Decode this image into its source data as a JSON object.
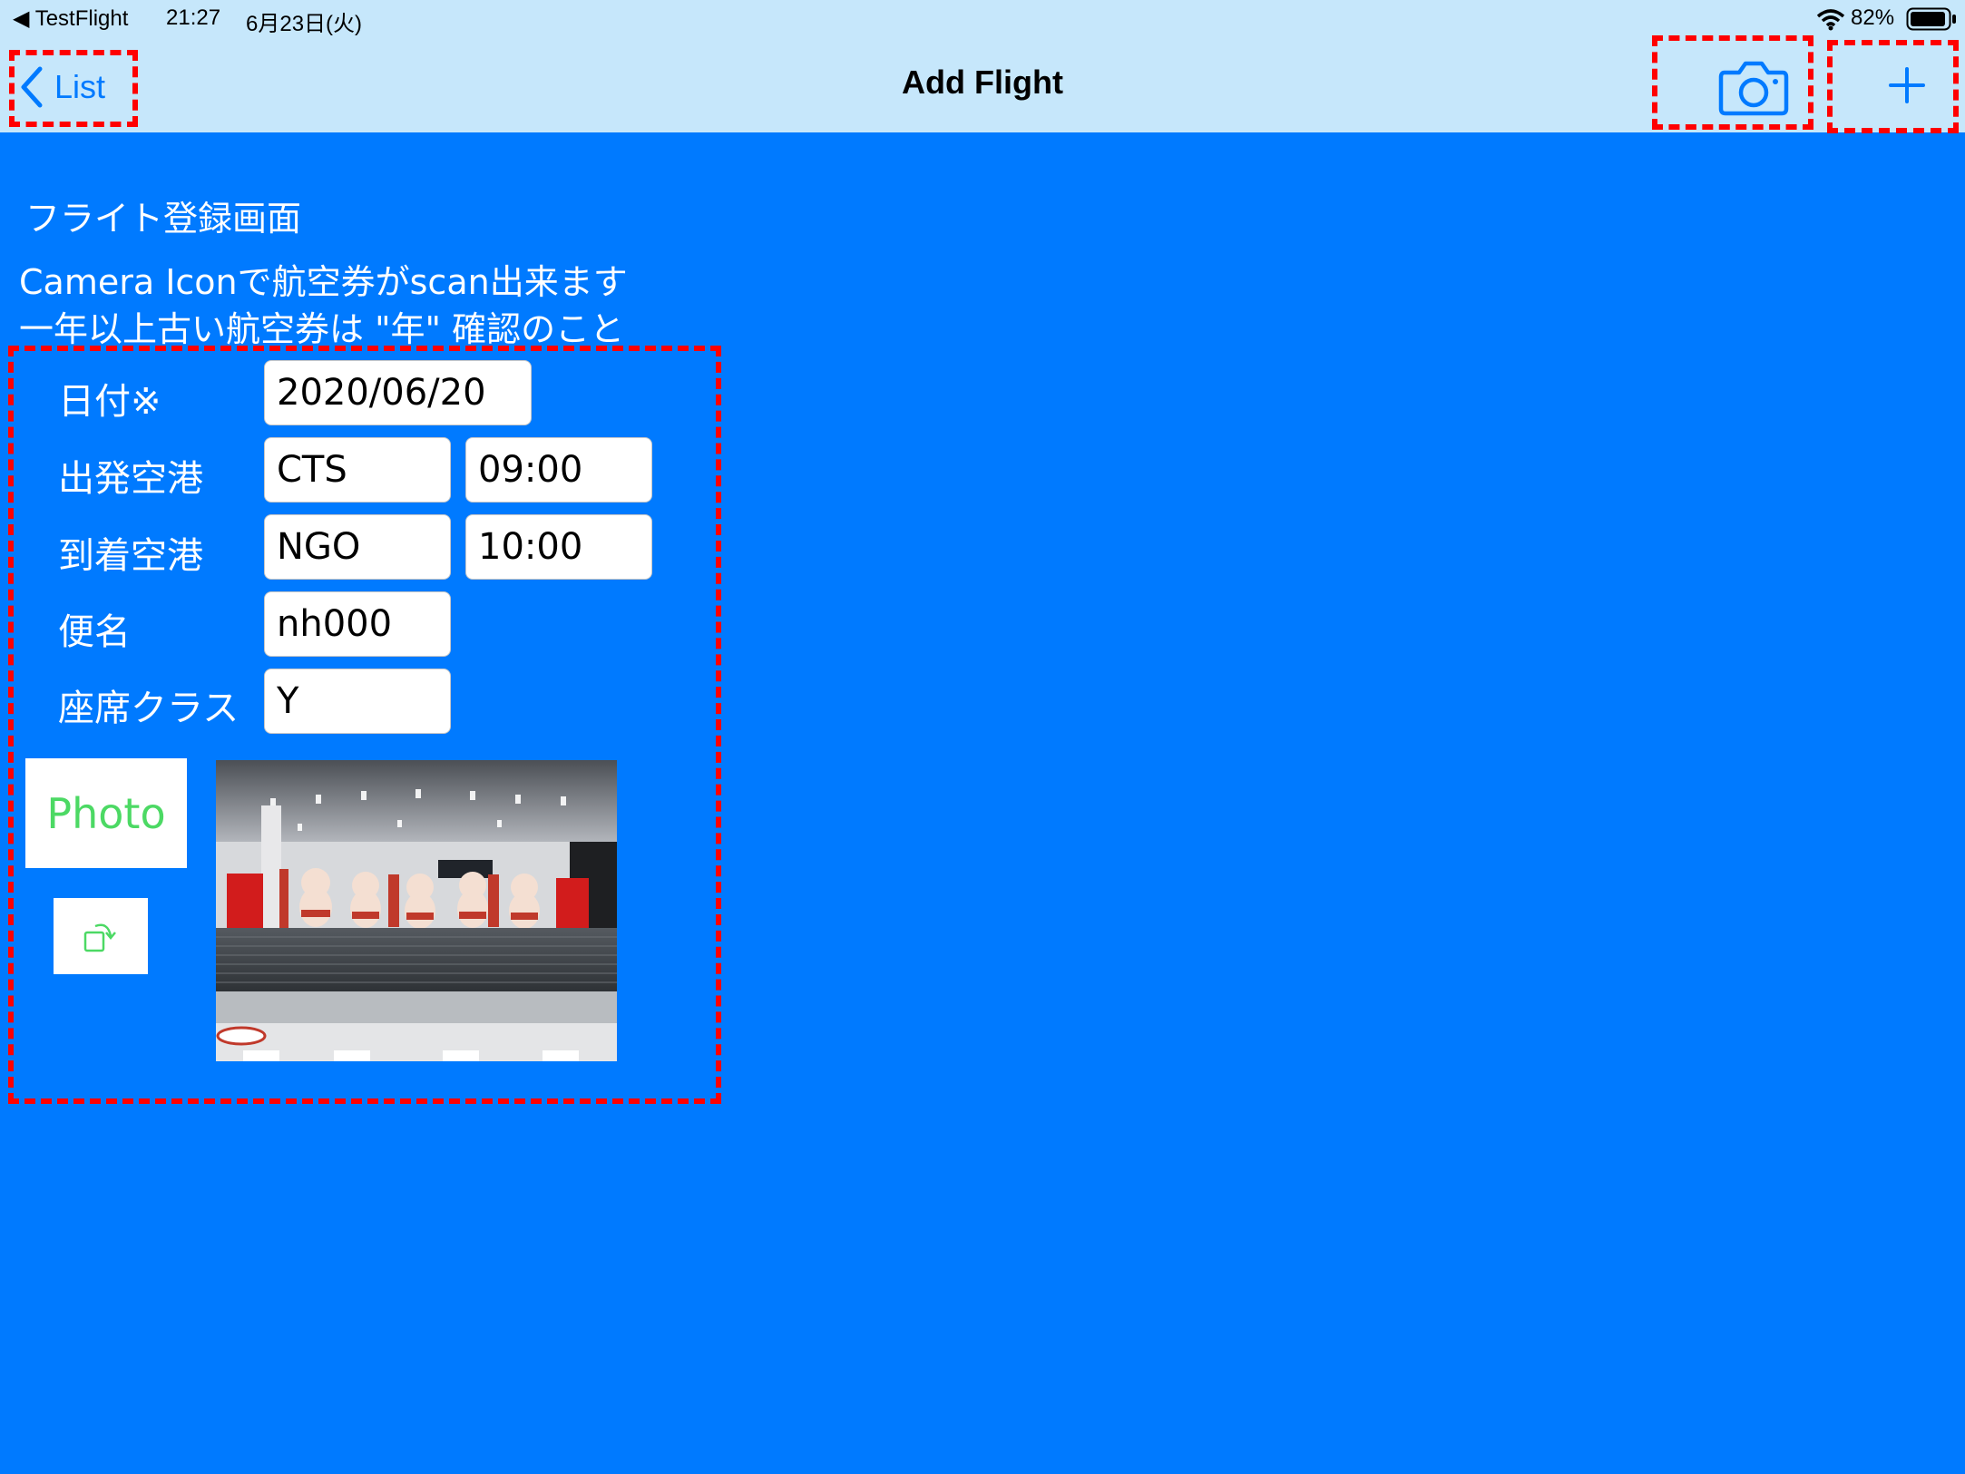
{
  "status_bar": {
    "back_app": "◀ TestFlight",
    "time": "21:27",
    "date": "6月23日(火)",
    "battery": "82%"
  },
  "nav": {
    "back_label": "List",
    "title": "Add Flight",
    "camera_icon": "camera-icon",
    "add_icon": "plus-icon"
  },
  "intro": {
    "heading": "フライト登録画面",
    "line1": "Camera Iconで航空券がscan出来ます",
    "line2": "一年以上古い航空券は \"年\" 確認のこと"
  },
  "form": {
    "date_label": "日付※",
    "date_value": "2020/06/20",
    "departure_label": "出発空港",
    "departure_airport": "CTS",
    "departure_time": "09:00",
    "arrival_label": "到着空港",
    "arrival_airport": "NGO",
    "arrival_time": "10:00",
    "flight_label": "便名",
    "flight_value": "nh000",
    "class_label": "座席クラス",
    "class_value": "Y"
  },
  "photo": {
    "button_label": "Photo",
    "rotate_icon": "rotate-icon"
  },
  "colors": {
    "background": "#007aff",
    "navbar": "#c6e7fb",
    "accent": "#007aff",
    "photo_label": "#4cd964",
    "highlight": "#ff0000"
  }
}
